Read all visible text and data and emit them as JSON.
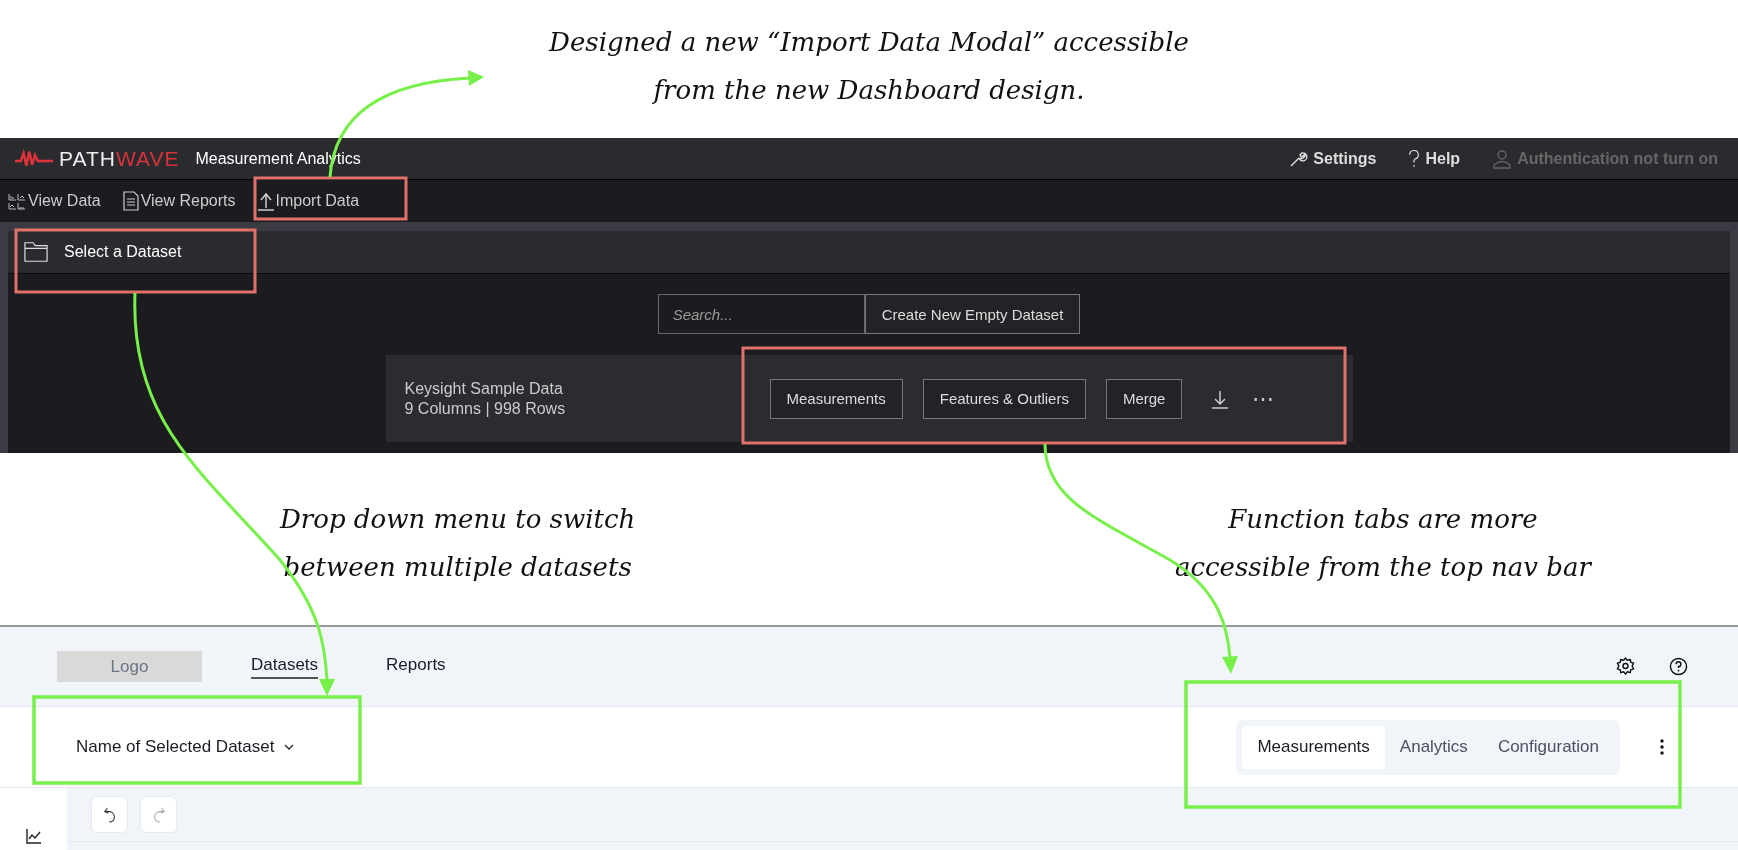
{
  "annotations": [
    {
      "text": "Designed a new “Import Data Modal” accessible\nfrom the new Dashboard design."
    },
    {
      "text": "Drop down menu to switch\nbetween multiple datasets"
    },
    {
      "text": "Function tabs are more\naccessible from the top nav bar"
    }
  ],
  "old_app": {
    "brand": {
      "logo_text": "PATH",
      "logo_accent": "WAVE",
      "product": "Measurement Analytics"
    },
    "header_links": [
      {
        "kind": "settings",
        "label": "Settings",
        "disabled": false
      },
      {
        "kind": "help",
        "label": "Help",
        "disabled": false
      },
      {
        "kind": "user",
        "label": "Authentication not turn on",
        "disabled": true
      }
    ],
    "nav": [
      {
        "kind": "view-data",
        "label": "View Data"
      },
      {
        "kind": "view-reports",
        "label": "View Reports"
      },
      {
        "kind": "import",
        "label": "Import Data"
      }
    ],
    "panel_title": "Select a Dataset",
    "search": {
      "placeholder": "Search..."
    },
    "create_button": "Create New Empty Dataset",
    "dataset": {
      "name": "Keysight Sample Data",
      "meta": "9 Columns | 998 Rows",
      "actions": [
        "Measurements",
        "Features & Outliers",
        "Merge"
      ],
      "more": "⋯"
    }
  },
  "new_app": {
    "logo_placeholder": "Logo",
    "nav": [
      {
        "label": "Datasets",
        "selected": true
      },
      {
        "label": "Reports",
        "selected": false
      }
    ],
    "dataset_selector": "Name of Selected Dataset",
    "tabs": [
      {
        "label": "Measurements",
        "selected": true
      },
      {
        "label": "Analytics",
        "selected": false
      },
      {
        "label": "Configuration",
        "selected": false
      }
    ]
  }
}
